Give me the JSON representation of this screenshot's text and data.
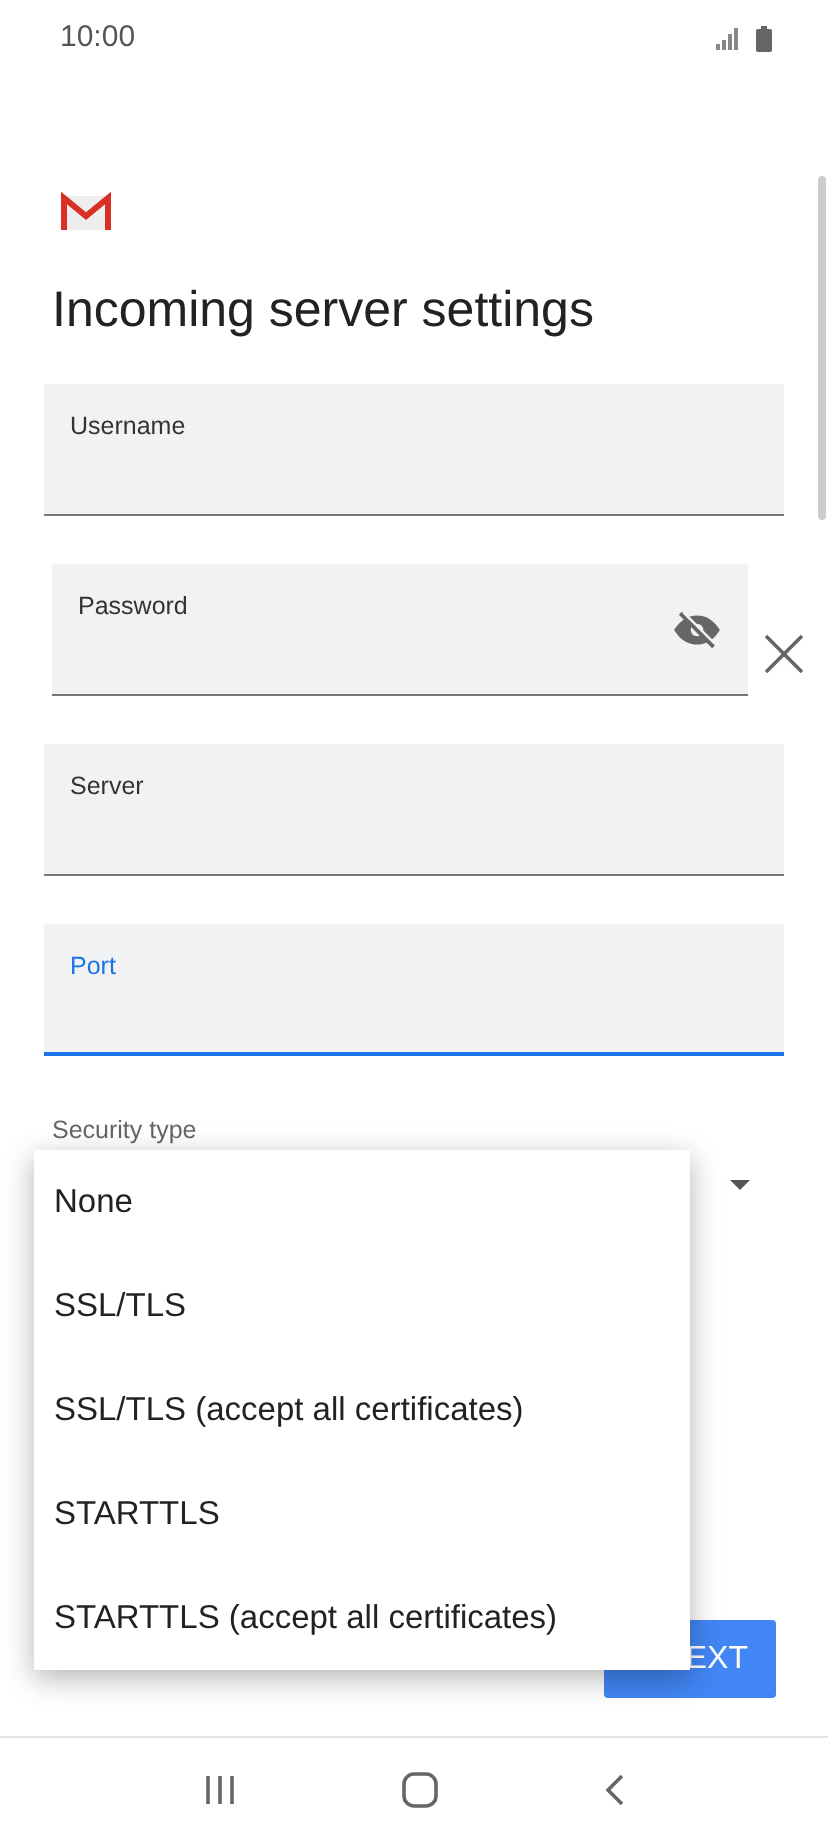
{
  "status_bar": {
    "time": "10:00"
  },
  "title": "Incoming server settings",
  "fields": [
    {
      "label": "Username",
      "kind": "text",
      "focused": false
    },
    {
      "label": "Password",
      "kind": "password",
      "focused": false
    },
    {
      "label": "Server",
      "kind": "text",
      "focused": false
    },
    {
      "label": "Port",
      "kind": "text",
      "focused": true
    }
  ],
  "security_type": {
    "label": "Security type",
    "expanded": true
  },
  "menu": [
    {
      "label": "None"
    },
    {
      "label": "SSL/TLS"
    },
    {
      "label": "SSL/TLS (accept all certificates)"
    },
    {
      "label": "STARTTLS"
    },
    {
      "label": "STARTTLS (accept all certificates)"
    }
  ],
  "next_button": "EXT"
}
